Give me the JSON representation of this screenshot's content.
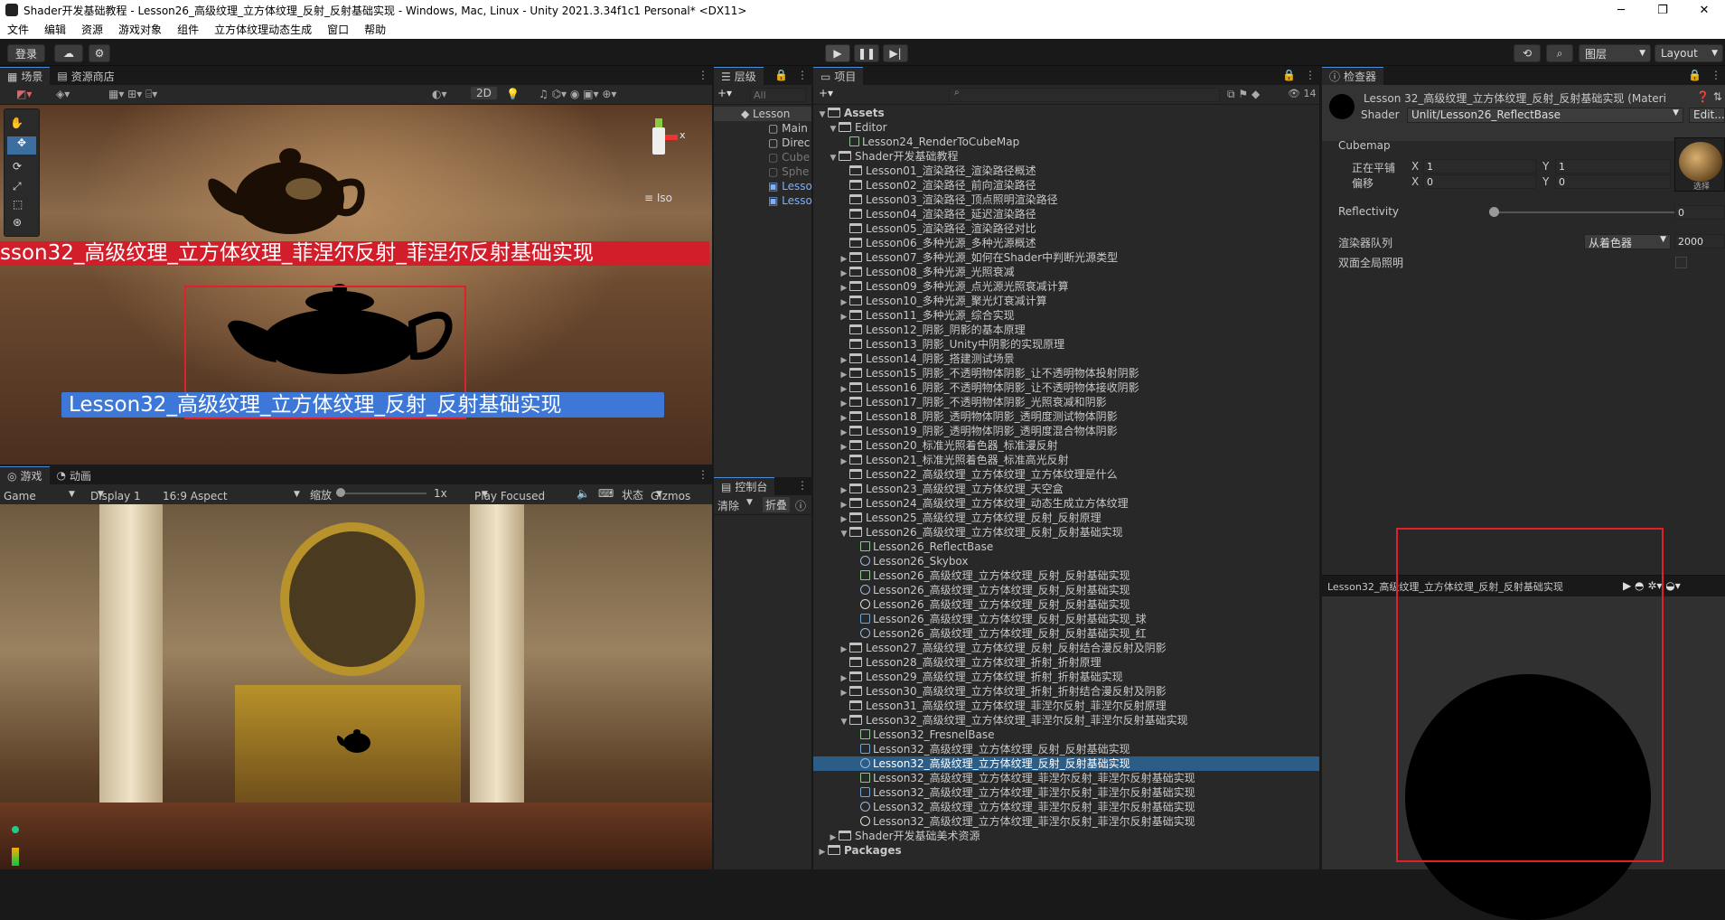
{
  "window": {
    "title": "Shader开发基础教程 - Lesson26_高级纹理_立方体纹理_反射_反射基础实现 - Windows, Mac, Linux - Unity 2021.3.34f1c1 Personal* <DX11>",
    "minimize": "─",
    "maximize": "❐",
    "close": "✕"
  },
  "menu": [
    "文件",
    "编辑",
    "资源",
    "游戏对象",
    "组件",
    "立方体纹理动态生成",
    "窗口",
    "帮助"
  ],
  "toolbar": {
    "login": "登录",
    "layers": "图层",
    "layout": "Layout"
  },
  "scene": {
    "tab_scene": "场景",
    "tab_store": "资源商店",
    "btn_2d": "2D",
    "iso": "Iso",
    "label_red": "sson32_高级纹理_立方体纹理_菲涅尔反射_菲涅尔反射基础实现",
    "label_blue": "Lesson32_高级纹理_立方体纹理_反射_反射基础实现",
    "gizmo_x": "x"
  },
  "game": {
    "tab_game": "游戏",
    "tab_anim": "动画",
    "mode": "Game",
    "display": "Display 1",
    "aspect": "16:9 Aspect",
    "scale_label": "缩放",
    "scale_value": "1x",
    "play_focused": "Play Focused",
    "stats": "状态",
    "gizmos": "Gizmos"
  },
  "hierarchy": {
    "tab": "层级",
    "search": "All",
    "items": [
      "Lesson",
      "Main",
      "Direc",
      "Cube",
      "Sphe",
      "Lesso",
      "Lesso"
    ]
  },
  "console": {
    "tab": "控制台",
    "clear": "清除",
    "collapse": "折叠"
  },
  "project": {
    "tab": "项目",
    "count": "14",
    "rows": [
      {
        "t": "Assets",
        "d": 0,
        "k": "fo",
        "a": "▼",
        "b": true
      },
      {
        "t": "Editor",
        "d": 1,
        "k": "fo",
        "a": "▼"
      },
      {
        "t": "Lesson24_RenderToCubeMap",
        "d": 2,
        "k": "cs"
      },
      {
        "t": "Shader开发基础教程",
        "d": 1,
        "k": "fo",
        "a": "▼"
      },
      {
        "t": "Lesson01_渲染路径_渲染路径概述",
        "d": 2,
        "k": "fo"
      },
      {
        "t": "Lesson02_渲染路径_前向渲染路径",
        "d": 2,
        "k": "fo"
      },
      {
        "t": "Lesson03_渲染路径_顶点照明渲染路径",
        "d": 2,
        "k": "fo"
      },
      {
        "t": "Lesson04_渲染路径_延迟渲染路径",
        "d": 2,
        "k": "fo"
      },
      {
        "t": "Lesson05_渲染路径_渲染路径对比",
        "d": 2,
        "k": "fo"
      },
      {
        "t": "Lesson06_多种光源_多种光源概述",
        "d": 2,
        "k": "fo"
      },
      {
        "t": "Lesson07_多种光源_如何在Shader中判断光源类型",
        "d": 2,
        "k": "fo",
        "a": "▶"
      },
      {
        "t": "Lesson08_多种光源_光照衰减",
        "d": 2,
        "k": "fo",
        "a": "▶"
      },
      {
        "t": "Lesson09_多种光源_点光源光照衰减计算",
        "d": 2,
        "k": "fo",
        "a": "▶"
      },
      {
        "t": "Lesson10_多种光源_聚光灯衰减计算",
        "d": 2,
        "k": "fo",
        "a": "▶"
      },
      {
        "t": "Lesson11_多种光源_综合实现",
        "d": 2,
        "k": "fo",
        "a": "▶"
      },
      {
        "t": "Lesson12_阴影_阴影的基本原理",
        "d": 2,
        "k": "fo"
      },
      {
        "t": "Lesson13_阴影_Unity中阴影的实现原理",
        "d": 2,
        "k": "fo"
      },
      {
        "t": "Lesson14_阴影_搭建测试场景",
        "d": 2,
        "k": "fo",
        "a": "▶"
      },
      {
        "t": "Lesson15_阴影_不透明物体阴影_让不透明物体投射阴影",
        "d": 2,
        "k": "fo",
        "a": "▶"
      },
      {
        "t": "Lesson16_阴影_不透明物体阴影_让不透明物体接收阴影",
        "d": 2,
        "k": "fo",
        "a": "▶"
      },
      {
        "t": "Lesson17_阴影_不透明物体阴影_光照衰减和阴影",
        "d": 2,
        "k": "fo",
        "a": "▶"
      },
      {
        "t": "Lesson18_阴影_透明物体阴影_透明度测试物体阴影",
        "d": 2,
        "k": "fo",
        "a": "▶"
      },
      {
        "t": "Lesson19_阴影_透明物体阴影_透明度混合物体阴影",
        "d": 2,
        "k": "fo",
        "a": "▶"
      },
      {
        "t": "Lesson20_标准光照着色器_标准漫反射",
        "d": 2,
        "k": "fo",
        "a": "▶"
      },
      {
        "t": "Lesson21_标准光照着色器_标准高光反射",
        "d": 2,
        "k": "fo",
        "a": "▶"
      },
      {
        "t": "Lesson22_高级纹理_立方体纹理_立方体纹理是什么",
        "d": 2,
        "k": "fo"
      },
      {
        "t": "Lesson23_高级纹理_立方体纹理_天空盒",
        "d": 2,
        "k": "fo",
        "a": "▶"
      },
      {
        "t": "Lesson24_高级纹理_立方体纹理_动态生成立方体纹理",
        "d": 2,
        "k": "fo",
        "a": "▶"
      },
      {
        "t": "Lesson25_高级纹理_立方体纹理_反射_反射原理",
        "d": 2,
        "k": "fo",
        "a": "▶"
      },
      {
        "t": "Lesson26_高级纹理_立方体纹理_反射_反射基础实现",
        "d": 2,
        "k": "fo",
        "a": "▼"
      },
      {
        "t": "Lesson26_ReflectBase",
        "d": 3,
        "k": "sh"
      },
      {
        "t": "Lesson26_Skybox",
        "d": 3,
        "k": "ma"
      },
      {
        "t": "Lesson26_高级纹理_立方体纹理_反射_反射基础实现",
        "d": 3,
        "k": "cs"
      },
      {
        "t": "Lesson26_高级纹理_立方体纹理_反射_反射基础实现",
        "d": 3,
        "k": "ma"
      },
      {
        "t": "Lesson26_高级纹理_立方体纹理_反射_反射基础实现",
        "d": 3,
        "k": "un"
      },
      {
        "t": "Lesson26_高级纹理_立方体纹理_反射_反射基础实现_球",
        "d": 3,
        "k": "cu"
      },
      {
        "t": "Lesson26_高级纹理_立方体纹理_反射_反射基础实现_红",
        "d": 3,
        "k": "ma"
      },
      {
        "t": "Lesson27_高级纹理_立方体纹理_反射_反射结合漫反射及阴影",
        "d": 2,
        "k": "fo",
        "a": "▶"
      },
      {
        "t": "Lesson28_高级纹理_立方体纹理_折射_折射原理",
        "d": 2,
        "k": "fo"
      },
      {
        "t": "Lesson29_高级纹理_立方体纹理_折射_折射基础实现",
        "d": 2,
        "k": "fo",
        "a": "▶"
      },
      {
        "t": "Lesson30_高级纹理_立方体纹理_折射_折射结合漫反射及阴影",
        "d": 2,
        "k": "fo",
        "a": "▶"
      },
      {
        "t": "Lesson31_高级纹理_立方体纹理_菲涅尔反射_菲涅尔反射原理",
        "d": 2,
        "k": "fo"
      },
      {
        "t": "Lesson32_高级纹理_立方体纹理_菲涅尔反射_菲涅尔反射基础实现",
        "d": 2,
        "k": "fo",
        "a": "▼"
      },
      {
        "t": "Lesson32_FresnelBase",
        "d": 3,
        "k": "sh"
      },
      {
        "t": "Lesson32_高级纹理_立方体纹理_反射_反射基础实现",
        "d": 3,
        "k": "cu"
      },
      {
        "t": "Lesson32_高级纹理_立方体纹理_反射_反射基础实现",
        "d": 3,
        "k": "ma",
        "sel": true
      },
      {
        "t": "Lesson32_高级纹理_立方体纹理_菲涅尔反射_菲涅尔反射基础实现",
        "d": 3,
        "k": "cs"
      },
      {
        "t": "Lesson32_高级纹理_立方体纹理_菲涅尔反射_菲涅尔反射基础实现",
        "d": 3,
        "k": "cu"
      },
      {
        "t": "Lesson32_高级纹理_立方体纹理_菲涅尔反射_菲涅尔反射基础实现",
        "d": 3,
        "k": "ma"
      },
      {
        "t": "Lesson32_高级纹理_立方体纹理_菲涅尔反射_菲涅尔反射基础实现",
        "d": 3,
        "k": "un"
      },
      {
        "t": "Shader开发基础美术资源",
        "d": 1,
        "k": "fo",
        "a": "▶"
      },
      {
        "t": "Packages",
        "d": 0,
        "k": "fo",
        "a": "▶",
        "b": true
      }
    ]
  },
  "inspector": {
    "tab": "检查器",
    "title": "Lesson 32_高级纹理_立方体纹理_反射_反射基础实现 (Materi",
    "shader_label": "Shader",
    "shader_value": "Unlit/Lesson26_ReflectBase",
    "edit": "Edit...",
    "cubemap": "Cubemap",
    "tiling": "正在平铺",
    "offset": "偏移",
    "x": "X",
    "y": "Y",
    "tiling_x": "1",
    "tiling_y": "1",
    "offset_x": "0",
    "offset_y": "0",
    "select": "选择",
    "reflectivity": "Reflectivity",
    "reflectivity_value": "0",
    "reflectivity_level": 0,
    "render_queue": "渲染器队列",
    "render_queue_mode": "从着色器",
    "render_queue_value": "2000",
    "double_sided_gi": "双面全局照明",
    "preview_title": "Lesson32_高级纹理_立方体纹理_反射_反射基础实现"
  },
  "colors": {
    "accent": "#4d8bd4",
    "selection": "#2c5d87",
    "red_box": "#e0202a",
    "red_label": "#d11e2a",
    "blue_label": "#3d78d8"
  }
}
